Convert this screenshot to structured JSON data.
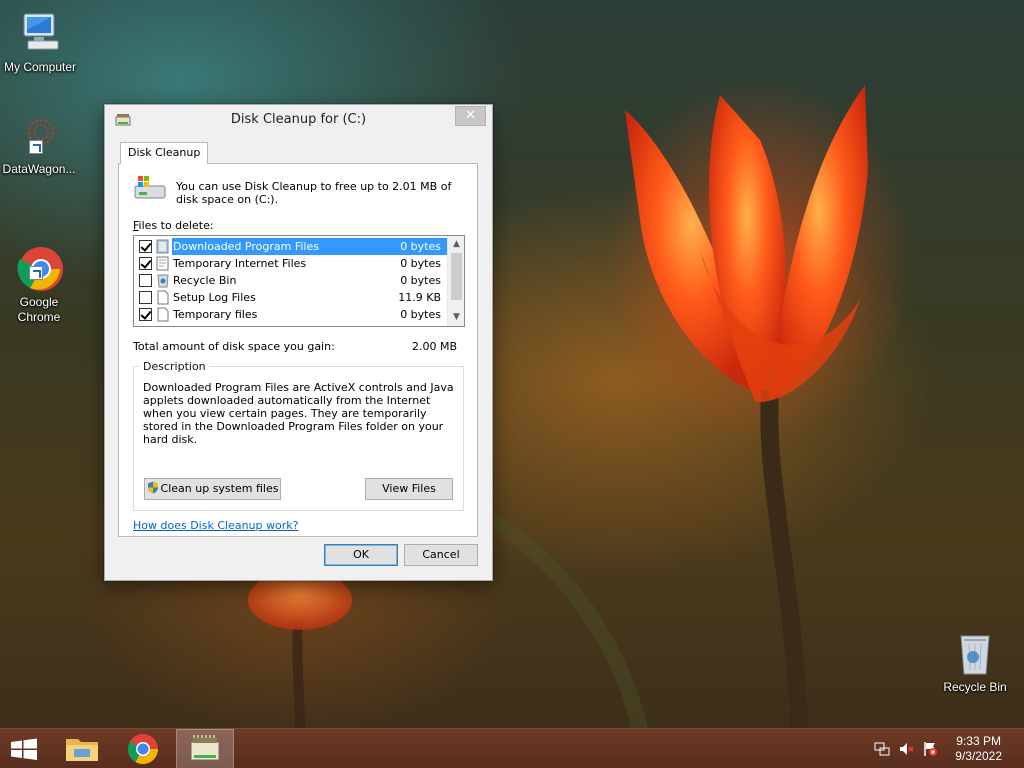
{
  "desktop": {
    "icons": [
      {
        "label": "My Computer"
      },
      {
        "label": "DataWagon..."
      },
      {
        "label": "Google\nChrome"
      },
      {
        "label": "Recycle Bin"
      }
    ]
  },
  "dialog": {
    "title": "Disk Cleanup for  (C:)",
    "close_glyph": "✕",
    "tab_label": "Disk Cleanup",
    "intro": "You can use Disk Cleanup to free up to 2.01 MB of disk space on  (C:).",
    "files_to_delete_prefix": "F",
    "files_to_delete_rest": "iles to delete:",
    "files": [
      {
        "name": "Downloaded Program Files",
        "size": "0 bytes",
        "checked": true,
        "selected": true,
        "icon": "folder-icon"
      },
      {
        "name": "Temporary Internet Files",
        "size": "0 bytes",
        "checked": true,
        "selected": false,
        "icon": "internet-files-icon"
      },
      {
        "name": "Recycle Bin",
        "size": "0 bytes",
        "checked": false,
        "selected": false,
        "icon": "recycle-bin-icon"
      },
      {
        "name": "Setup Log Files",
        "size": "11.9 KB",
        "checked": false,
        "selected": false,
        "icon": "file-icon"
      },
      {
        "name": "Temporary files",
        "size": "0 bytes",
        "checked": true,
        "selected": false,
        "icon": "file-icon"
      }
    ],
    "total_label": "Total amount of disk space you gain:",
    "total_value": "2.00 MB",
    "description_legend": "Description",
    "description_text": "Downloaded Program Files are ActiveX controls and Java applets downloaded automatically from the Internet when you view certain pages. They are temporarily stored in the Downloaded Program Files folder on your hard disk.",
    "cleanup_system_button": "Clean up system files",
    "view_files_button": "View Files",
    "help_link": "How does Disk Cleanup work?",
    "ok_button": "OK",
    "cancel_button": "Cancel"
  },
  "taskbar": {
    "time": "9:33 PM",
    "date": "9/3/2022"
  },
  "colors": {
    "selection": "#3399ff",
    "link": "#0066cc"
  }
}
